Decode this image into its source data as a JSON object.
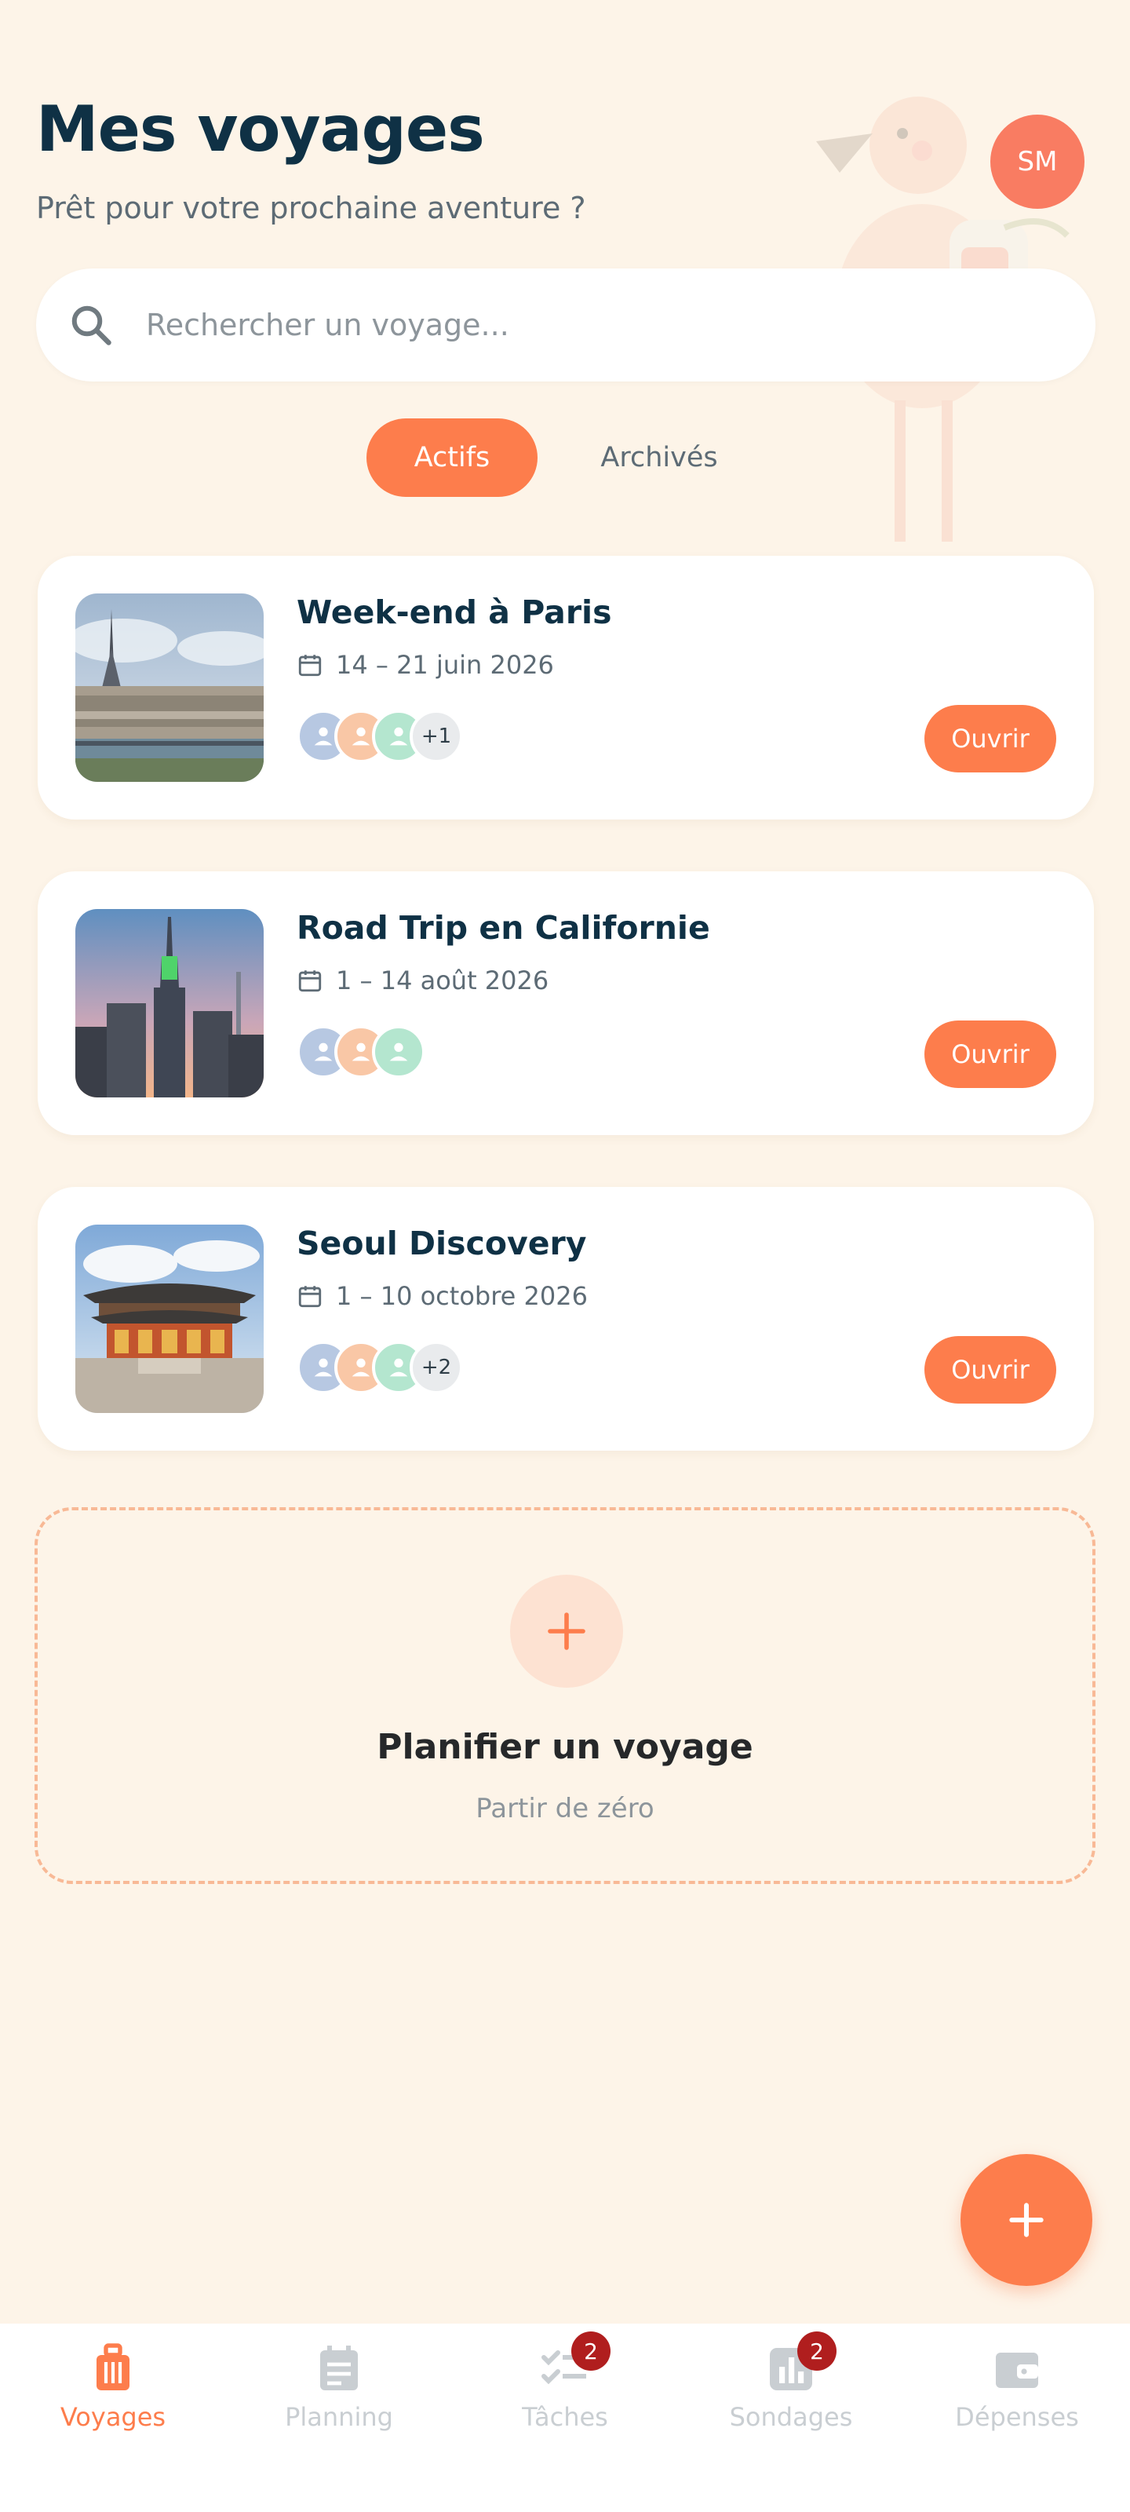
{
  "header": {
    "title": "Mes voyages",
    "subtitle": "Prêt pour votre prochaine aventure ?",
    "avatar_initials": "SM"
  },
  "search": {
    "placeholder": "Rechercher un voyage..."
  },
  "tabs": {
    "active": "Actifs",
    "archived": "Archivés"
  },
  "trips": [
    {
      "name": "Week-end à Paris",
      "dates": "14 – 21 juin 2026",
      "extra_members": "+1",
      "open_label": "Ouvrir"
    },
    {
      "name": "Road Trip en Californie",
      "dates": "1 – 14 août 2026",
      "extra_members": "",
      "open_label": "Ouvrir"
    },
    {
      "name": "Seoul Discovery",
      "dates": "1 – 10 octobre 2026",
      "extra_members": "+2",
      "open_label": "Ouvrir"
    }
  ],
  "plan": {
    "plus": "+",
    "title": "Planifier un voyage",
    "subtitle": "Partir de zéro"
  },
  "nav": {
    "voyages": "Voyages",
    "planning": "Planning",
    "taches": "Tâches",
    "taches_badge": "2",
    "sondages": "Sondages",
    "sondages_badge": "2",
    "depenses": "Dépenses"
  },
  "colors": {
    "accent": "#fd7d4c",
    "background": "#fdf4e8",
    "title": "#0f3145",
    "badge": "#b01e1e",
    "avatar": "#f97c62"
  },
  "icons": [
    "search-icon",
    "calendar-icon",
    "user-icon",
    "plus-icon",
    "luggage-icon",
    "planning-icon",
    "tasks-icon",
    "polls-icon",
    "wallet-icon"
  ]
}
